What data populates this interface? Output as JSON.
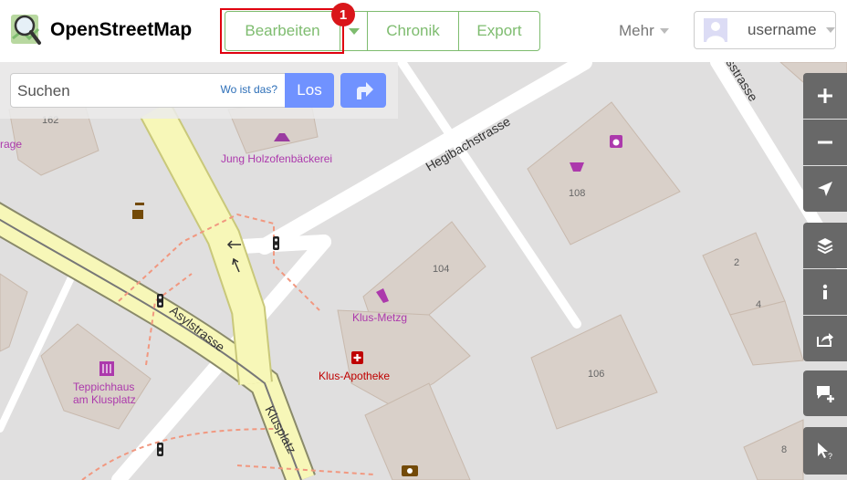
{
  "header": {
    "brand": "OpenStreetMap",
    "edit_label": "Bearbeiten",
    "history_label": "Chronik",
    "export_label": "Export",
    "more_label": "Mehr",
    "username": "username",
    "badge": "1"
  },
  "search": {
    "placeholder": "Suchen",
    "where_label": "Wo ist das?",
    "go_label": "Los"
  },
  "map": {
    "labels": {
      "bakery": "Jung Holzofenbäckerei",
      "street_hegibach": "Hegibachstrasse",
      "street_asyl": "Asylstrasse",
      "street_klus": "Klusplatz",
      "street_top": "sstrasse",
      "butcher": "Klus-Metzg",
      "pharmacy": "Klus-Apotheke",
      "carpet_1": "Teppichhaus",
      "carpet_2": "am Klusplatz",
      "garage": "rage",
      "num_162": "162",
      "num_108": "108",
      "num_104": "104",
      "num_106": "106",
      "num_2": "2",
      "num_4": "4",
      "num_8": "8"
    }
  },
  "controls": [
    "zoom-in-icon",
    "zoom-out-icon",
    "locate-icon",
    "layers-icon",
    "info-icon",
    "share-icon",
    "note-icon",
    "query-icon"
  ]
}
